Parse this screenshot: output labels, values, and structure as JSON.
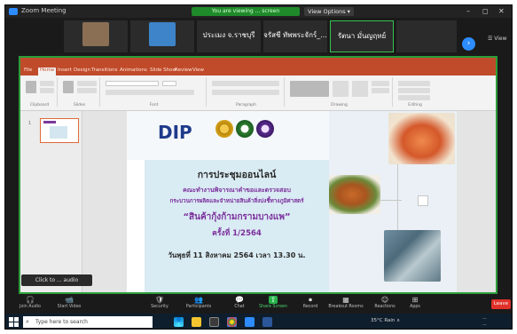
{
  "zoom_window": {
    "title": "Zoom Meeting",
    "minimize": "–",
    "restore": "◻",
    "close": "✕"
  },
  "share_banner": "You are viewing ... screen",
  "view_options": "View Options ▾",
  "view_label": "☰ View",
  "participants": [
    {
      "name": "",
      "big": ""
    },
    {
      "name": "",
      "big": ""
    },
    {
      "name": "",
      "big": "ประเมง จ.ราชบุรี"
    },
    {
      "name": "",
      "big": "จรัสชี ทัพพระจักร์_..."
    },
    {
      "name": "",
      "big": "รัตนา มั่นญฤทย์"
    },
    {
      "name": "",
      "big": ""
    }
  ],
  "ppt": {
    "tabs": [
      "File",
      "Home",
      "Insert",
      "Design",
      "Transitions",
      "Animations",
      "Slide Show",
      "Review",
      "View"
    ],
    "ribbon_groups": [
      "Clipboard",
      "Slides",
      "Font",
      "Paragraph",
      "Drawing",
      "Editing"
    ],
    "thumb_number": "1"
  },
  "slide": {
    "logo": "DIP",
    "title": "การประชุมออนไลน์",
    "subtitle1": "คณะทำงานพิจารณาคำขอและตรวจสอบ",
    "subtitle2": "กระบวนการผลิตและจำหน่ายสินค้าสิ่งบ่งชี้ทางภูมิศาสตร์",
    "product": "“สินค้ากุ้งก้ามกรามบางแพ”",
    "round": "ครั้งที่ 1/2564",
    "date": "วันพุธที่ 11 สิงหาคม 2564 เวลา 13.30 น."
  },
  "caption": "Click to ... audio",
  "toolbar": [
    {
      "icon": "🎧",
      "label": "Join Audio"
    },
    {
      "icon": "📹",
      "label": "Start Video"
    },
    {
      "icon": "🛡",
      "label": "Security"
    },
    {
      "icon": "👥",
      "label": "Participants"
    },
    {
      "icon": "💬",
      "label": "Chat"
    },
    {
      "icon": "⇧",
      "label": "Share Screen"
    },
    {
      "icon": "⏺",
      "label": "Record"
    },
    {
      "icon": "▦",
      "label": "Breakout Rooms"
    },
    {
      "icon": "☺",
      "label": "Reactions"
    },
    {
      "icon": "⊞",
      "label": "Apps"
    }
  ],
  "leave_label": "Leave",
  "taskbar": {
    "search_placeholder": "Type here to search",
    "tray": "35°C Rain  ∧",
    "time": "...",
    "date": "..."
  },
  "colors": {
    "zoom_blue": "#2d8cff",
    "share_green": "#2d9d3a",
    "ppt_red": "#c04b2a",
    "slide_purple": "#7b2e9c"
  }
}
